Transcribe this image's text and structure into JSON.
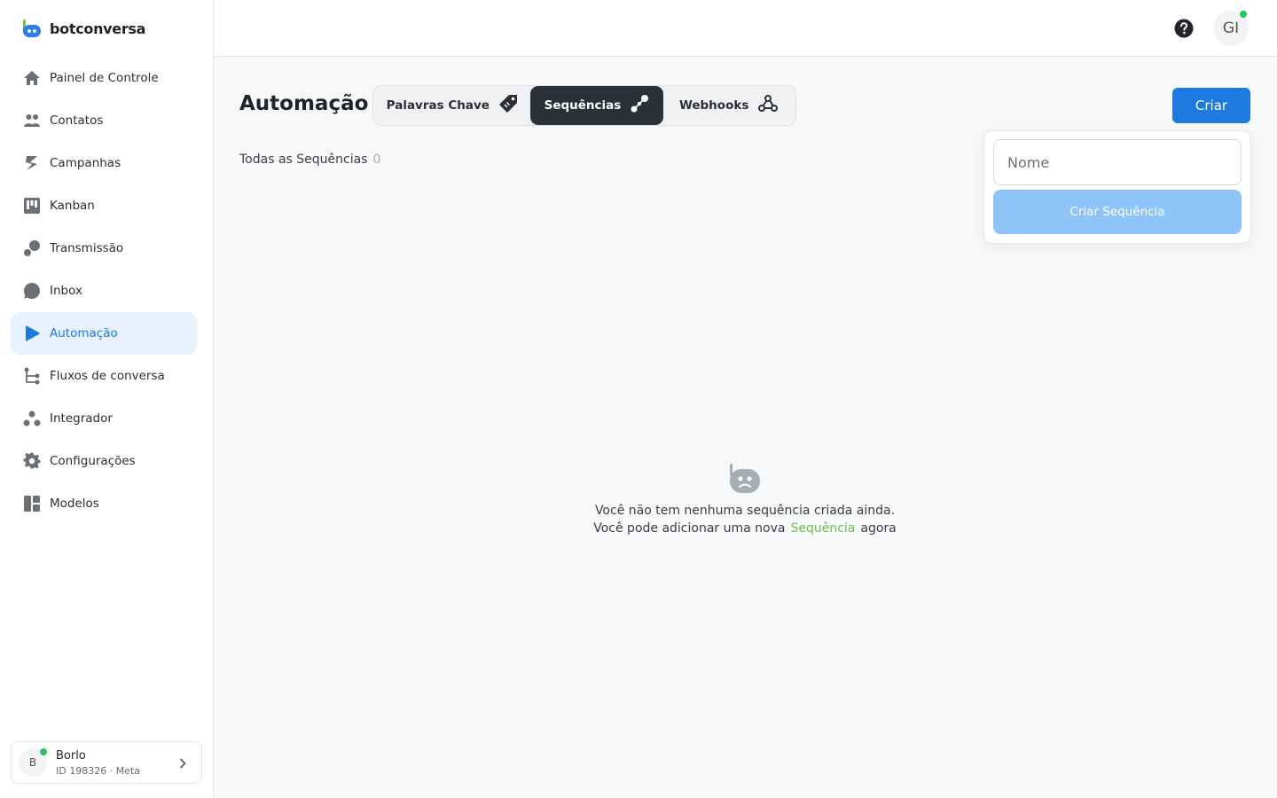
{
  "brand": {
    "name": "botconversa"
  },
  "sidebar": {
    "items": [
      {
        "label": "Painel de Controle",
        "icon": "home-icon"
      },
      {
        "label": "Contatos",
        "icon": "users-icon"
      },
      {
        "label": "Campanhas",
        "icon": "campaign-icon"
      },
      {
        "label": "Kanban",
        "icon": "kanban-icon"
      },
      {
        "label": "Transmissão",
        "icon": "broadcast-icon"
      },
      {
        "label": "Inbox",
        "icon": "chat-bubble-icon"
      },
      {
        "label": "Automação",
        "icon": "play-icon",
        "active": true
      },
      {
        "label": "Fluxos de conversa",
        "icon": "flow-icon"
      },
      {
        "label": "Integrador",
        "icon": "integration-icon"
      },
      {
        "label": "Configurações",
        "icon": "gear-icon"
      },
      {
        "label": "Modelos",
        "icon": "templates-icon"
      }
    ],
    "account": {
      "initial": "B",
      "name": "Borlo",
      "sub": "ID 198326 · Meta"
    }
  },
  "header": {
    "user_initials": "GI"
  },
  "main": {
    "title": "Automação",
    "tabs": [
      {
        "label": "Palavras Chave",
        "icon": "tag-icon"
      },
      {
        "label": "Sequências",
        "icon": "sequence-icon",
        "active": true
      },
      {
        "label": "Webhooks",
        "icon": "webhook-icon"
      }
    ],
    "create_label": "Criar",
    "popover": {
      "name_placeholder": "Nome",
      "submit_label": "Criar Sequência"
    },
    "list": {
      "title": "Todas as Sequências",
      "count": "0"
    },
    "empty": {
      "line1": "Você não tem nenhuma sequência criada ainda.",
      "line2_pre": "Você pode adicionar uma nova",
      "line2_link": "Sequência",
      "line2_post": "agora"
    }
  },
  "colors": {
    "accent": "#1f7ae0",
    "active_bg": "#e8f2ff",
    "online": "#22c55e",
    "link_green": "#6cc04a"
  }
}
